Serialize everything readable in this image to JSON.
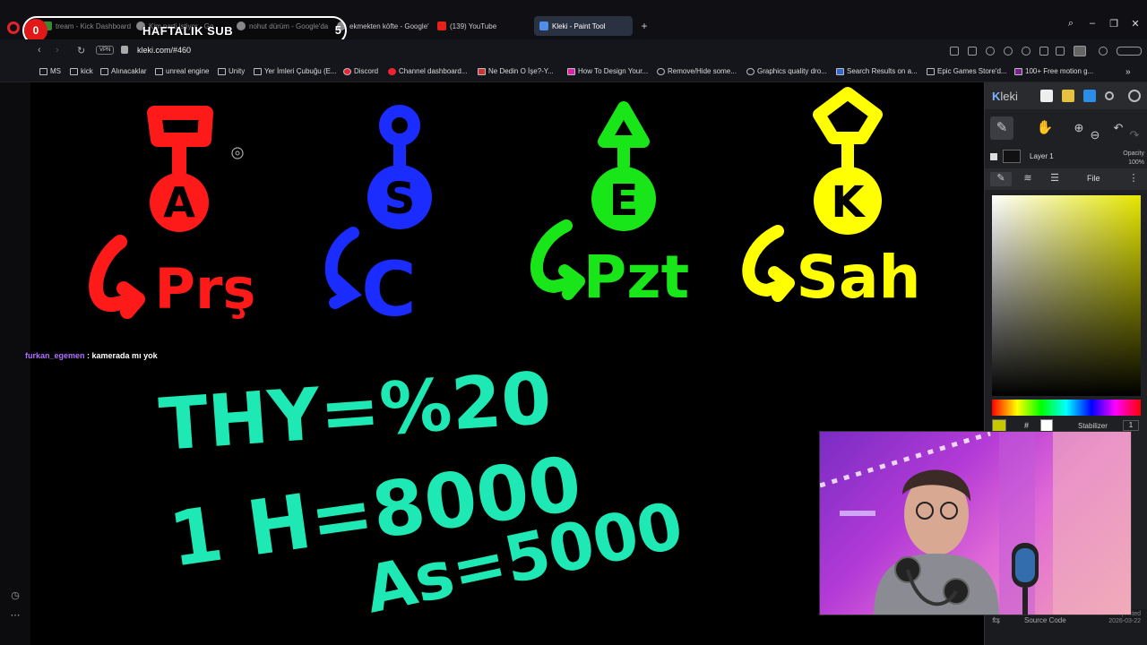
{
  "tabs": [
    {
      "label": "tream - Kick Dashboard",
      "active": false,
      "color": "#52d84b"
    },
    {
      "label": "Kim parti istiyor - Go",
      "active": false,
      "color": "#cfcfcf"
    },
    {
      "label": "nohut dürüm - Google'da",
      "active": false,
      "color": "#cfcfcf"
    },
    {
      "label": "ekmekten köfte - Google'",
      "active": false,
      "color": "#cfcfcf"
    },
    {
      "label": "(139) YouTube",
      "active": false,
      "color": "#e62117"
    },
    {
      "label": "Kleki - Paint Tool",
      "active": true,
      "color": "#4f8de8"
    }
  ],
  "overlay": {
    "badge": "0",
    "label": "HAFTALIK SUB",
    "count": "5"
  },
  "address": {
    "vpn": "VPN",
    "url": "kleki.com/#460"
  },
  "bookmarks": [
    "MS",
    "kick",
    "Alınacaklar",
    "unreal engine",
    "Unity",
    "Yer İmleri Çubuğu (E...",
    "Discord",
    "Channel dashboard...",
    "Ne Dedin O İşe?-Y...",
    "How To Design Your...",
    "Remove/Hide some...",
    "Graphics quality dro...",
    "Search Results on a...",
    "Epic Games Store'd...",
    "100+ Free motion g..."
  ],
  "drawing": {
    "figures": [
      {
        "letter": "A",
        "label": "Prş",
        "color": "#ff1a1a",
        "top": "shovel"
      },
      {
        "letter": "S",
        "label": "C",
        "color": "#1a2cff",
        "top": "circle"
      },
      {
        "letter": "E",
        "label": "Pzt",
        "color": "#19e619",
        "top": "triangle"
      },
      {
        "letter": "K",
        "label": "Sah",
        "color": "#ffff00",
        "top": "diamond"
      }
    ],
    "formula_color": "#1ee8b4",
    "formula_lines": [
      "THY=%20",
      "1 H=8000",
      "As=5000"
    ]
  },
  "chat": {
    "user": "furkan_egemen",
    "sep": " : ",
    "message": "kamerada mı yok"
  },
  "kleki": {
    "logo_k": "K",
    "logo_rest": "leki",
    "layer_name": "Layer 1",
    "opacity_label": "Opacity",
    "opacity_value": "100%",
    "file_label": "File",
    "hash": "#",
    "stabilizer_label": "Stabilizer",
    "stabilizer_value": "1",
    "source_code": "Source Code",
    "updated_label": "Updated",
    "updated_date": "2026-03-22",
    "accent": "#c8c800"
  }
}
